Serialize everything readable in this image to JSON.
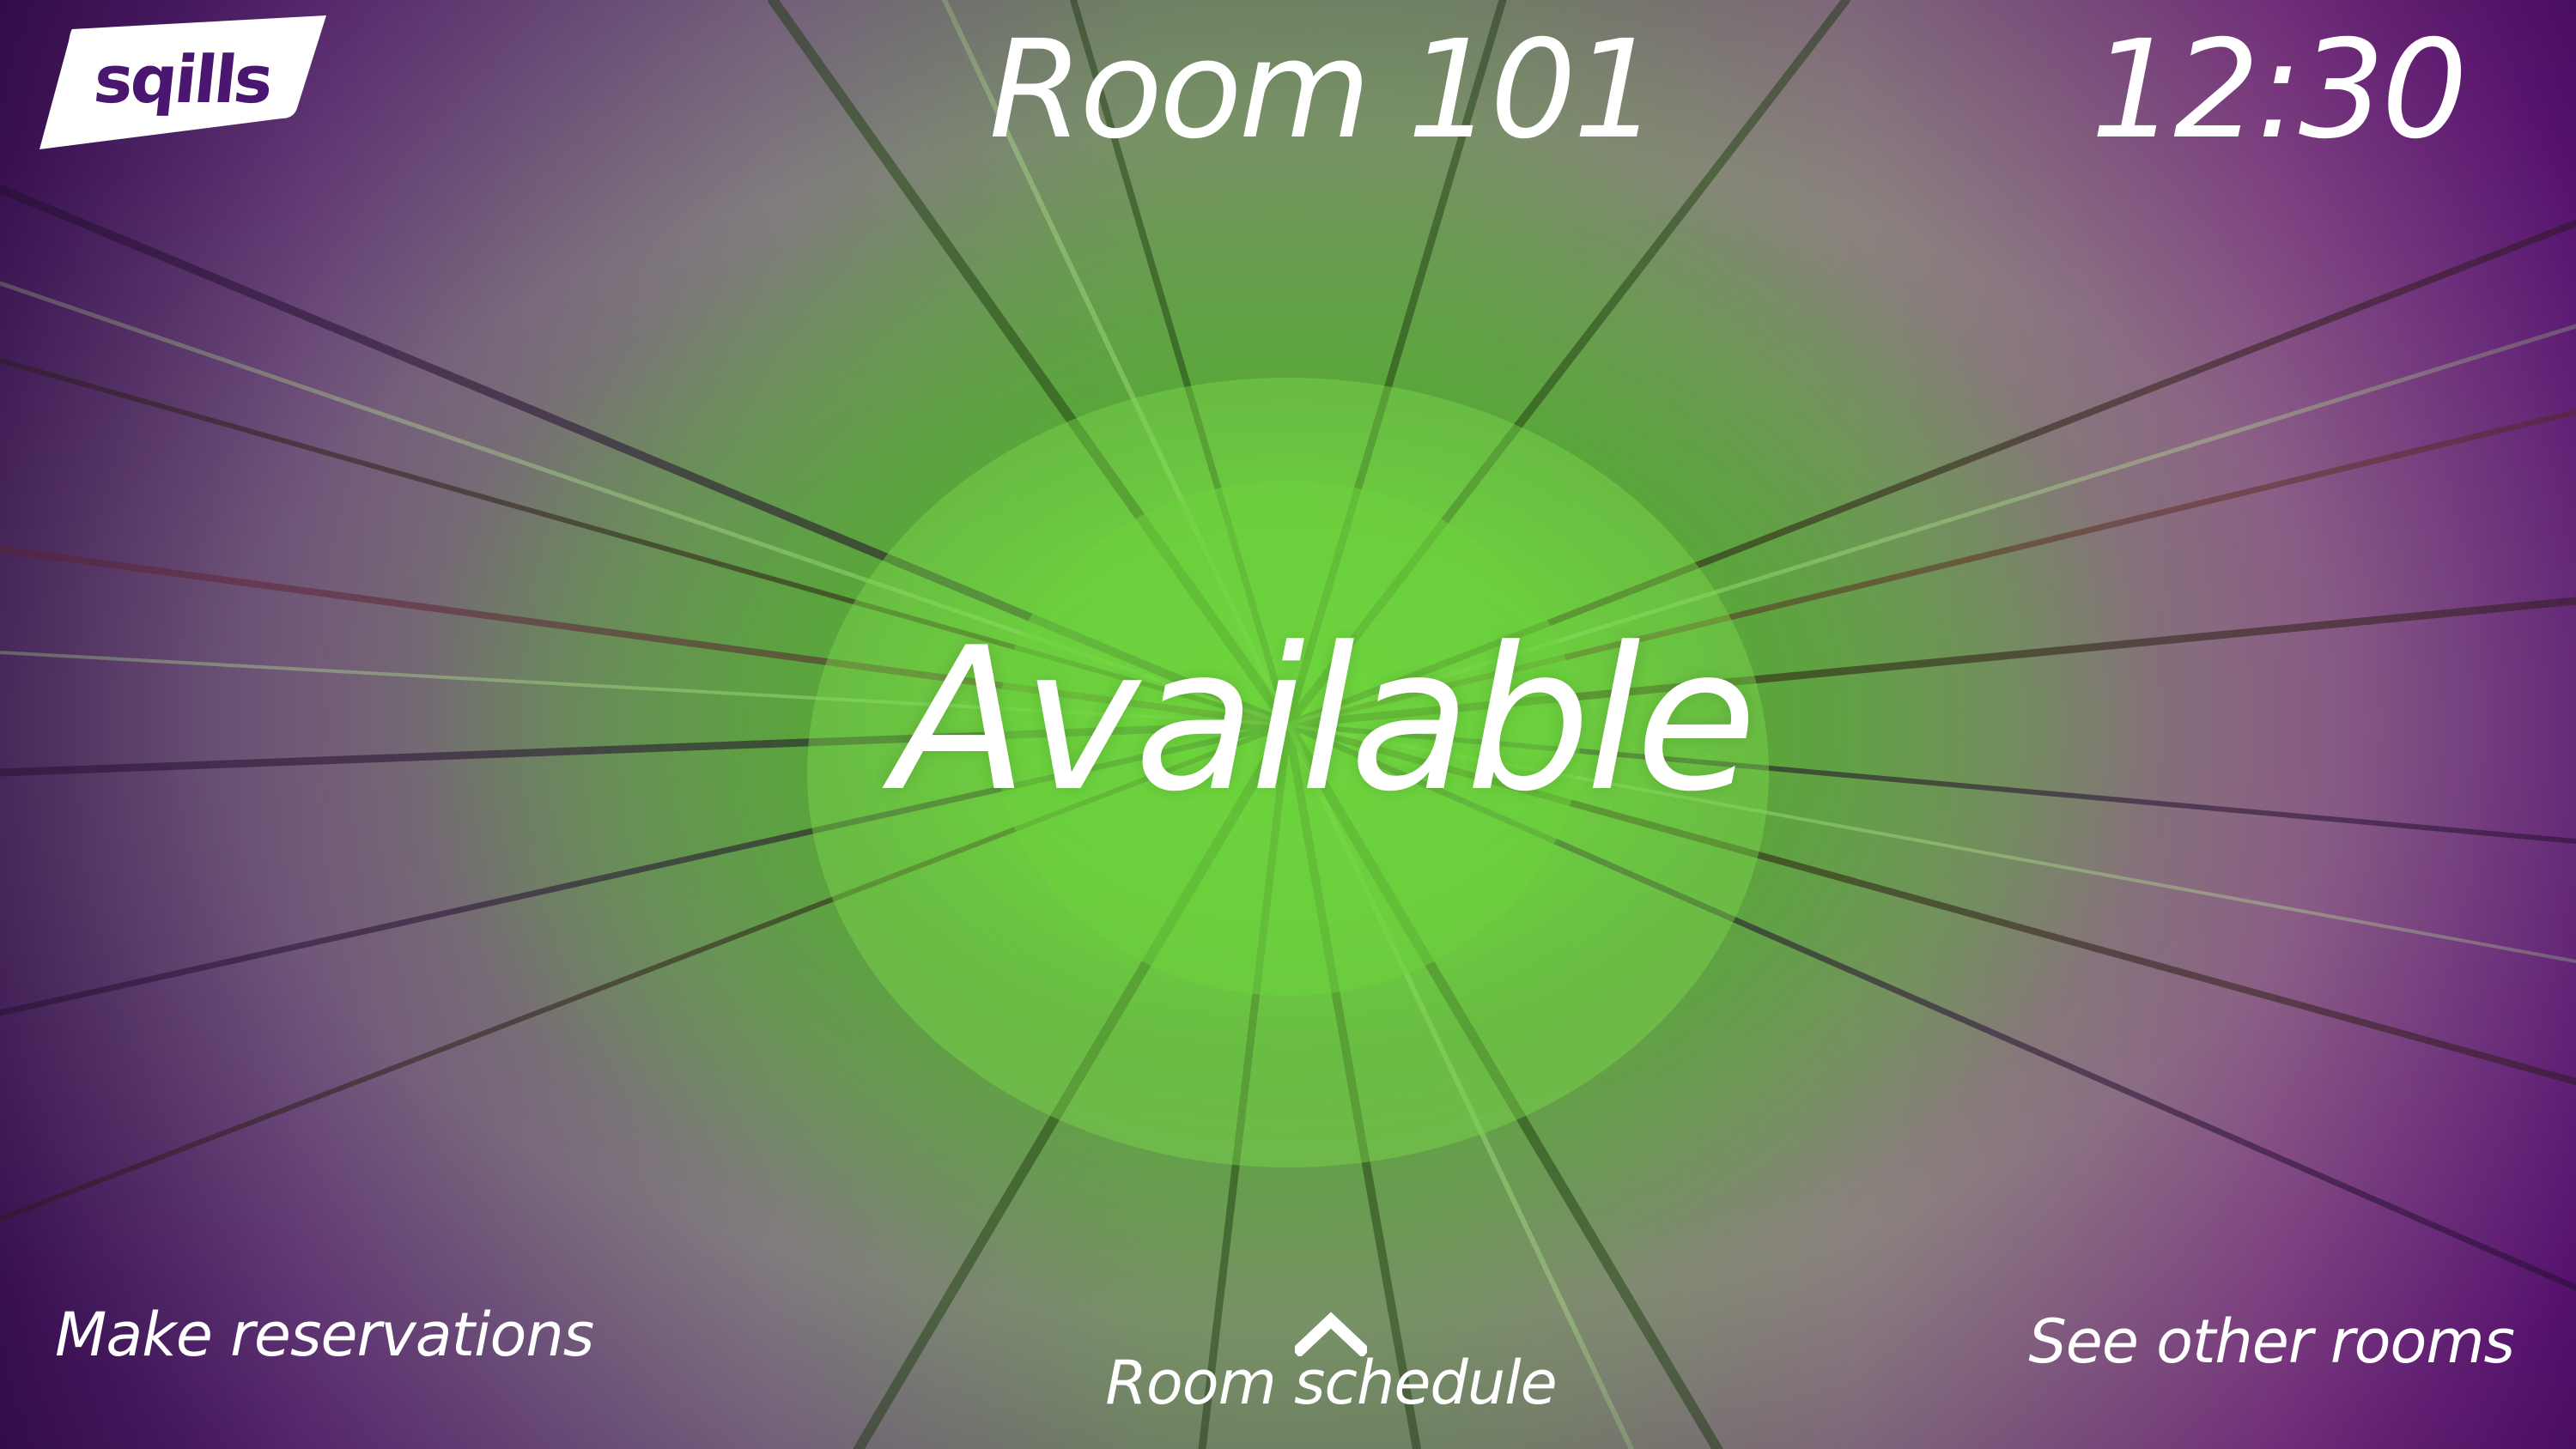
{
  "brand": {
    "logo_text": "sqills",
    "logo_text_color": "#4a1670",
    "logo_badge_color": "#ffffff"
  },
  "header": {
    "room_name": "Room 101",
    "clock": "12:30"
  },
  "status": {
    "label": "Available",
    "color": "#66cc33"
  },
  "footer": {
    "make_reservations": "Make reservations",
    "room_schedule": "Room schedule",
    "room_schedule_icon": "chevron-up-icon",
    "see_other_rooms": "See other rooms"
  },
  "theme": {
    "accent_purple": "#6a0e8a",
    "accent_green": "#66cc33",
    "text_color": "#ffffff"
  }
}
